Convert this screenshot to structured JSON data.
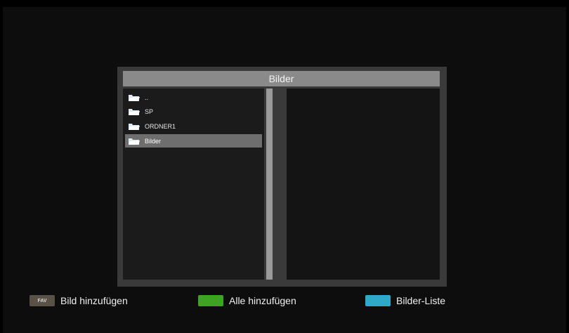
{
  "dialog": {
    "title": "Bilder"
  },
  "file_list": [
    {
      "label": "..",
      "icon": "folder-icon",
      "selected": false
    },
    {
      "label": "SP",
      "icon": "folder-icon",
      "selected": false
    },
    {
      "label": "ORDNER1",
      "icon": "folder-icon",
      "selected": false
    },
    {
      "label": "Bilder",
      "icon": "folder-icon",
      "selected": true
    }
  ],
  "legend": {
    "fav_key": "FAV",
    "fav_label": "Bild hinzufügen",
    "green_label": "Alle hinzufügen",
    "cyan_label": "Bilder-Liste"
  },
  "colors": {
    "green_key": "#3ea323",
    "cyan_key": "#2fa9c8",
    "selection": "#6e6e6e"
  }
}
